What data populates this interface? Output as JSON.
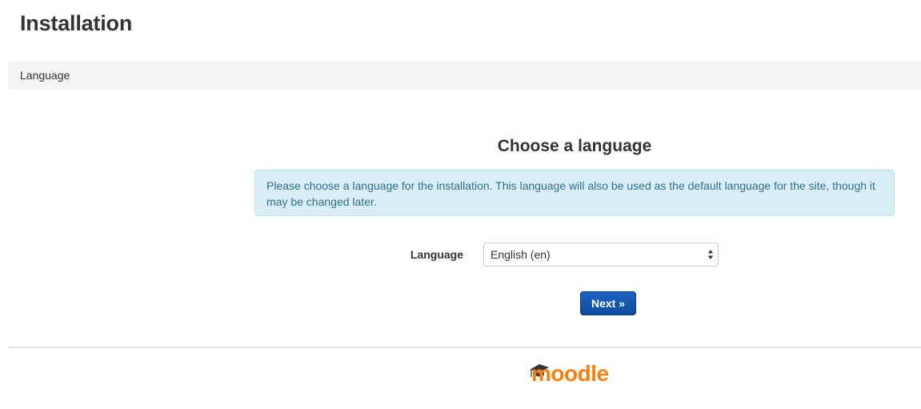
{
  "page": {
    "title": "Installation"
  },
  "navbar": {
    "breadcrumb": "Language"
  },
  "main": {
    "heading": "Choose a language",
    "info_text": "Please choose a language for the installation. This language will also be used as the default language for the site, though it may be changed later.",
    "language_field": {
      "label": "Language",
      "selected_value": "English (en)"
    },
    "next_button_label": "Next »"
  },
  "footer": {
    "logo_text": "moodle",
    "logo_icon": "graduation-cap-icon"
  },
  "colors": {
    "info_background": "#d9edf7",
    "info_text": "#31708f",
    "button_primary": "#1b5fba",
    "logo_orange": "#f98012",
    "navbar_background": "#f5f5f5"
  }
}
